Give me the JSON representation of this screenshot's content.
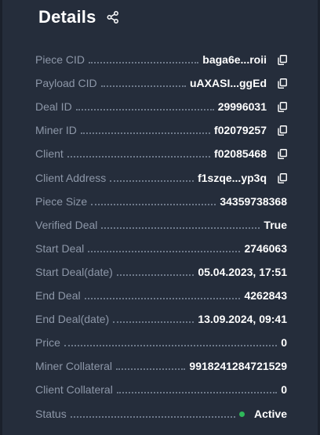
{
  "header": {
    "title": "Details",
    "share_icon": "share-icon"
  },
  "colors": {
    "background": "#252d3b",
    "label": "#8d97a8",
    "value": "#ffffff",
    "status_active": "#2fb85a"
  },
  "rows": [
    {
      "key": "piece-cid",
      "label": "Piece CID",
      "value": "baga6e...roii",
      "copy": true
    },
    {
      "key": "payload-cid",
      "label": "Payload CID",
      "value": "uAXASI...ggEd",
      "copy": true
    },
    {
      "key": "deal-id",
      "label": "Deal ID",
      "value": "29996031",
      "copy": true
    },
    {
      "key": "miner-id",
      "label": "Miner ID",
      "value": "f02079257",
      "copy": true
    },
    {
      "key": "client",
      "label": "Client",
      "value": "f02085468",
      "copy": true
    },
    {
      "key": "client-address",
      "label": "Client Address",
      "value": "f1szqe...yp3q",
      "copy": true
    },
    {
      "key": "piece-size",
      "label": "Piece Size",
      "value": "34359738368",
      "copy": false
    },
    {
      "key": "verified-deal",
      "label": "Verified Deal",
      "value": "True",
      "copy": false
    },
    {
      "key": "start-deal",
      "label": "Start Deal",
      "value": "2746063",
      "copy": false
    },
    {
      "key": "start-deal-date",
      "label": "Start Deal(date)",
      "value": "05.04.2023, 17:51",
      "copy": false
    },
    {
      "key": "end-deal",
      "label": "End Deal",
      "value": "4262843",
      "copy": false
    },
    {
      "key": "end-deal-date",
      "label": "End Deal(date)",
      "value": "13.09.2024, 09:41",
      "copy": false
    },
    {
      "key": "price",
      "label": "Price",
      "value": "0",
      "copy": false
    },
    {
      "key": "miner-collateral",
      "label": "Miner Collateral",
      "value": "9918241284721529",
      "copy": false
    },
    {
      "key": "client-collateral",
      "label": "Client Collateral",
      "value": "0",
      "copy": false
    },
    {
      "key": "status",
      "label": "Status",
      "value": "Active",
      "copy": false,
      "status_dot": true
    }
  ]
}
